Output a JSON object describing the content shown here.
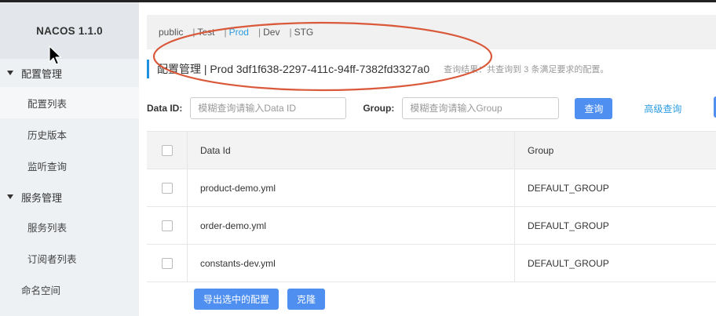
{
  "brand": "NACOS 1.1.0",
  "sidebar": {
    "groups": [
      {
        "label": "配置管理",
        "items": [
          "配置列表",
          "历史版本",
          "监听查询"
        ]
      },
      {
        "label": "服务管理",
        "items": [
          "服务列表",
          "订阅者列表"
        ]
      }
    ],
    "namespace_link": "命名空间"
  },
  "namespaces": {
    "items": [
      "public",
      "Test",
      "Prod",
      "Dev",
      "STG"
    ],
    "separator": "|",
    "active": "Prod"
  },
  "title": {
    "text": "配置管理 | Prod 3df1f638-2297-411c-94ff-7382fd3327a0",
    "result": "查询结果：共查询到 3 条满足要求的配置。"
  },
  "search": {
    "data_id_label": "Data ID:",
    "data_id_placeholder": "模糊查询请输入Data ID",
    "group_label": "Group:",
    "group_placeholder": "模糊查询请输入Group",
    "query_button": "查询",
    "advanced_link": "高级查询"
  },
  "table": {
    "headers": [
      "Data Id",
      "Group"
    ],
    "rows": [
      {
        "data_id": "product-demo.yml",
        "group": "DEFAULT_GROUP"
      },
      {
        "data_id": "order-demo.yml",
        "group": "DEFAULT_GROUP"
      },
      {
        "data_id": "constants-dev.yml",
        "group": "DEFAULT_GROUP"
      }
    ]
  },
  "actions": {
    "export_selected": "导出选中的配置",
    "clone": "克隆"
  },
  "colors": {
    "accent": "#2c9ce3",
    "primary_button": "#4f8ff0",
    "annotation": "#d9593a"
  }
}
